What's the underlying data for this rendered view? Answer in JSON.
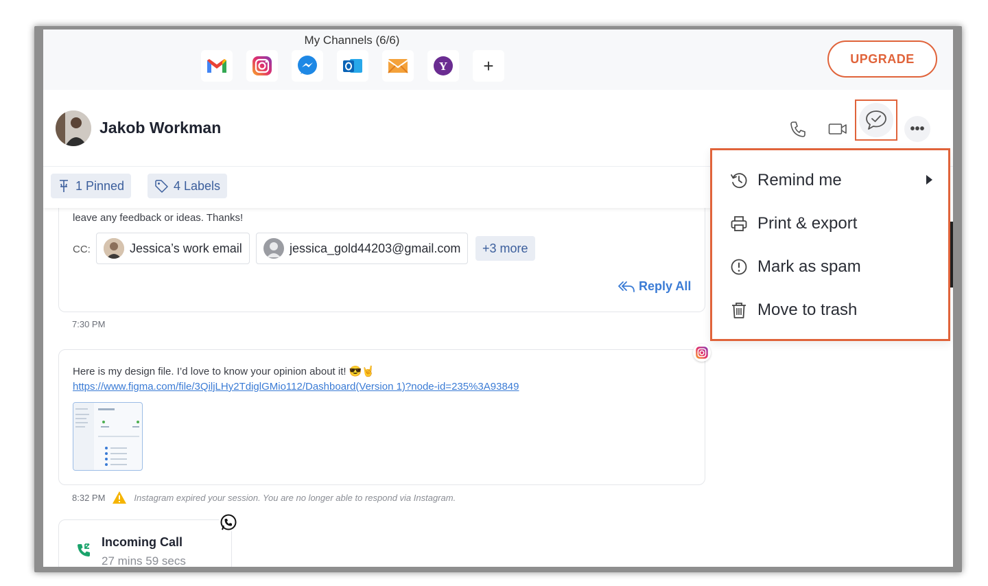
{
  "channels": {
    "title": "My Channels (6/6)",
    "items": [
      "gmail-icon",
      "instagram-icon",
      "messenger-icon",
      "outlook-icon",
      "email-icon",
      "yahoo-icon",
      "add-icon"
    ],
    "add_label": "+"
  },
  "upgrade": {
    "label": "UPGRADE",
    "color": "#e0633a"
  },
  "contact": {
    "name": "Jakob Workman"
  },
  "header_actions": [
    "phone-icon",
    "video-icon",
    "chat-check-icon",
    "more-icon"
  ],
  "more_label": "•••",
  "tags": {
    "pinned_label": "1 Pinned",
    "labels_label": "4 Labels"
  },
  "message1": {
    "body": "leave any feedback or ideas. Thanks!",
    "cc_label": "CC:",
    "cc": [
      {
        "label": "Jessica’s work email"
      },
      {
        "label": "jessica_gold44203@gmail.com"
      }
    ],
    "cc_more": "+3 more",
    "reply_all": "Reply All",
    "time": "7:30 PM"
  },
  "message2": {
    "body": "Here is my design file. I’d love to know your opinion about it! 😎🤘",
    "link": "https://www.figma.com/file/3QiljLHy2TdiglGMio112/Dashboard(Version 1)?node-id=235%3A93849",
    "channel": "instagram-icon",
    "time": "8:32 PM",
    "warning": "Instagram expired your session. You are no longer able to respond via Instagram."
  },
  "call": {
    "title": "Incoming Call",
    "duration": "27 mins 59 secs",
    "channel": "whatsapp-icon"
  },
  "menu": {
    "items": [
      {
        "label": "Remind me",
        "icon": "history-icon",
        "has_submenu": true
      },
      {
        "label": "Print & export",
        "icon": "printer-icon"
      },
      {
        "label": "Mark as spam",
        "icon": "alert-circle-icon"
      },
      {
        "label": "Move to trash",
        "icon": "trash-icon"
      }
    ]
  },
  "colors": {
    "accent": "#e0633a",
    "link": "#3a7bd5",
    "chip_bg": "#e9edf4",
    "chip_text": "#3b5e9c"
  }
}
